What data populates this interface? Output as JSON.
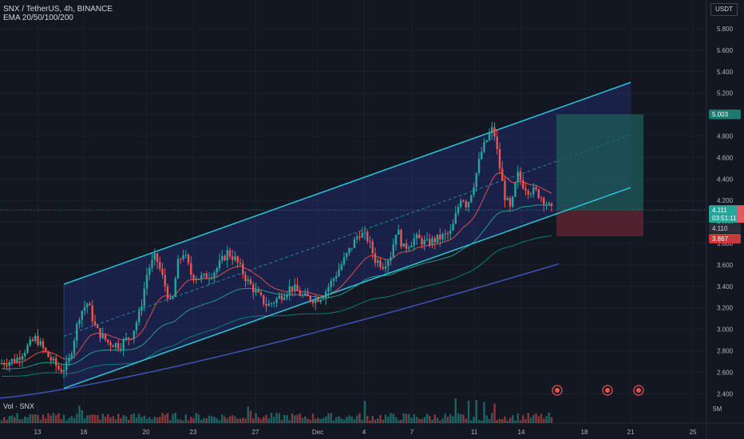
{
  "header": {
    "symbol_line": "SNX / TetherUS, 4h, BINANCE",
    "indicator_line": "EMA 20/50/100/200",
    "currency": "USDT"
  },
  "volume_pane": {
    "label": "Vol · SNX",
    "scale_label": "5M"
  },
  "price_labels": {
    "target": "5.003",
    "current": "4.111",
    "countdown": "03:51:11",
    "ema_value": "4.110",
    "stop": "3.867"
  },
  "colors": {
    "background": "#131722",
    "up": "#26a69a",
    "down": "#ef5350",
    "channel": "#26c6da",
    "channel_fill": "#283593",
    "ema20": "#ef5350",
    "ema50": "#26a69a",
    "ema100": "#00897b",
    "ema200": "#3f51b5",
    "target_zone": "#1e5c5a",
    "stop_zone": "#5c2330"
  },
  "chart_data": {
    "type": "candlestick",
    "y_ticks": [
      "5.800",
      "5.600",
      "5.400",
      "5.200",
      "5.000",
      "4.800",
      "4.600",
      "4.400",
      "4.200",
      "4.000",
      "3.800",
      "3.600",
      "3.400",
      "3.200",
      "3.000",
      "2.800",
      "2.600",
      "2.400"
    ],
    "x_ticks": [
      "13",
      "16",
      "20",
      "23",
      "27",
      "Dec",
      "4",
      "7",
      "11",
      "14",
      "18",
      "21",
      "25"
    ],
    "ylim": [
      2.35,
      5.95
    ],
    "channel": {
      "upper_start": {
        "x": "Nov 15",
        "y": 3.42
      },
      "upper_end": {
        "x": "Dec 20",
        "y": 5.3
      },
      "lower_start": {
        "x": "Nov 15",
        "y": 2.45
      },
      "lower_end": {
        "x": "Dec 20",
        "y": 4.32
      }
    },
    "position": {
      "entry": 4.111,
      "target": 5.003,
      "stop": 3.867
    },
    "ema200_visible_end": 3.61
  }
}
